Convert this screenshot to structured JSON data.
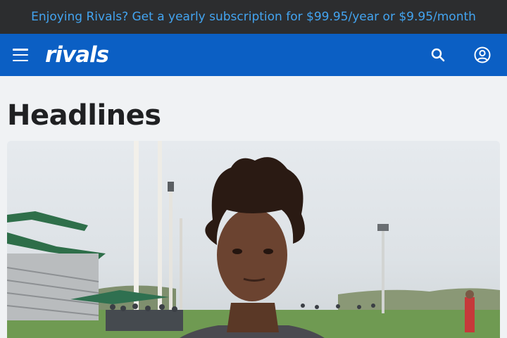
{
  "promo": {
    "text": "Enjoying Rivals? Get a yearly subscription for $99.95/year or $9.95/month",
    "color": "#43a4f0",
    "background": "#2c2d2f"
  },
  "nav": {
    "logo": "rivals",
    "background": "#0b5fc4",
    "menu_icon": "hamburger-menu-icon",
    "search_icon": "search-icon",
    "account_icon": "account-circle-icon"
  },
  "main": {
    "section_title": "Headlines",
    "hero_image": "athlete-portrait-photo"
  }
}
